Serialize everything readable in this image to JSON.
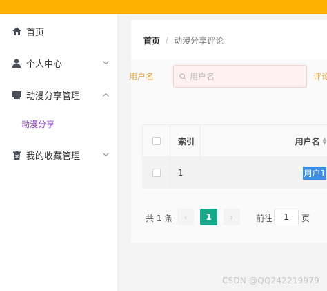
{
  "colors": {
    "topbar": "#ffb000",
    "accent_purple": "#8a3fbf",
    "search_label": "#e6a23c",
    "pager_active": "#17a889",
    "selection_highlight": "#3b8de8"
  },
  "sidebar": {
    "items": [
      {
        "label": "首页",
        "icon": "home-icon"
      },
      {
        "label": "个人中心",
        "icon": "user-icon",
        "has_chevron": true
      },
      {
        "label": "动漫分享管理",
        "icon": "folder-icon",
        "has_chevron": true,
        "expanded": true
      },
      {
        "label": "我的收藏管理",
        "icon": "trash-icon",
        "has_chevron": true
      }
    ],
    "subitems": [
      {
        "label": "动漫分享"
      }
    ]
  },
  "breadcrumb": {
    "home": "首页",
    "separator": "/",
    "current": "动漫分享评论"
  },
  "search": {
    "label": "用户名",
    "placeholder": "用户名",
    "next_label": "评论"
  },
  "table": {
    "headers": [
      "索引",
      "用户名"
    ],
    "rows": [
      {
        "index": "1",
        "username": "用户1"
      }
    ]
  },
  "pagination": {
    "total": "共 1 条",
    "current_page": "1",
    "goto_label": "前往",
    "goto_value": "1",
    "page_suffix": "页",
    "prev": "‹",
    "next": "›"
  },
  "watermark": "CSDN @QQ242219979"
}
